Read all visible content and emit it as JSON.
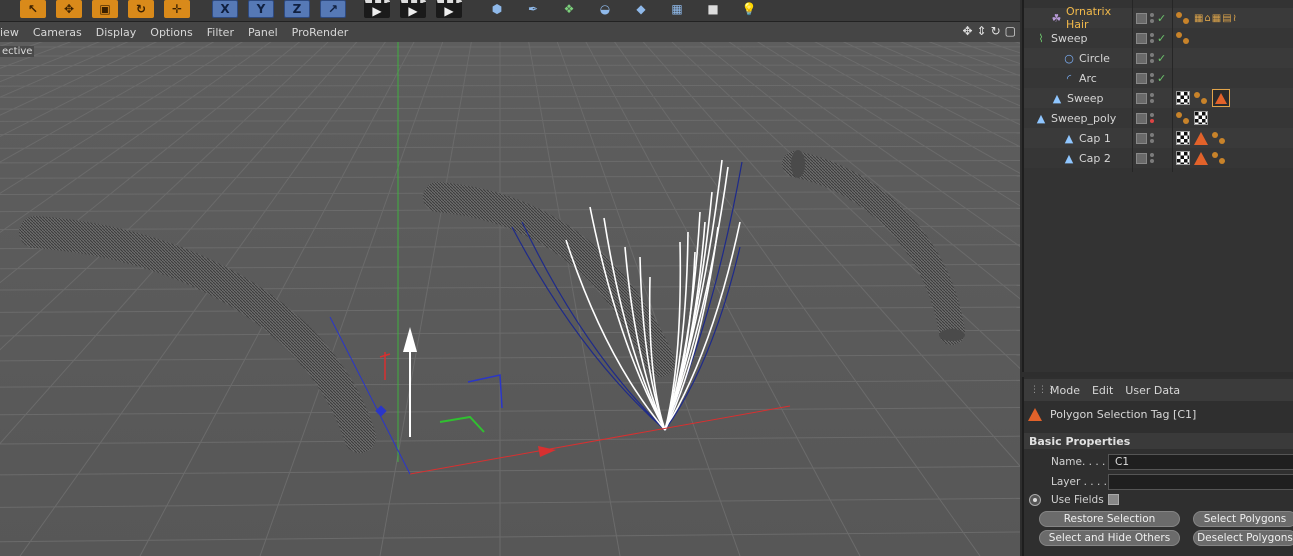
{
  "toolbar": {
    "icons": [
      "undo-arrow-icon",
      "move-icon",
      "scale-icon",
      "rotate-icon",
      "move-all-icon",
      "x-axis-icon",
      "y-axis-icon",
      "z-axis-icon",
      "coordinate-system-icon",
      "render-view-icon",
      "render-picture-viewer-icon",
      "render-settings-icon",
      "cube-icon",
      "spline-pen-icon",
      "generator-icon",
      "deformer-icon",
      "scene-icon",
      "floor-icon",
      "camera-icon",
      "light-icon"
    ],
    "x_label": "X",
    "y_label": "Y",
    "z_label": "Z"
  },
  "viewport": {
    "menu": [
      "iew",
      "Cameras",
      "Display",
      "Options",
      "Filter",
      "Panel",
      "ProRender"
    ],
    "label": "ective",
    "nav_icons": [
      "pan-icon",
      "dolly-icon",
      "rotate-view-icon",
      "maximize-icon"
    ]
  },
  "object_manager": {
    "rows": [
      {
        "name": "Ornatrix Hair",
        "icon": "hair-icon",
        "highlight": true,
        "check": true,
        "tags": [
          "dots",
          "hair-tags"
        ]
      },
      {
        "name": "Sweep",
        "icon": "sweep-icon",
        "check": true,
        "tags": [
          "dots"
        ]
      },
      {
        "name": "Circle",
        "icon": "circle-spline-icon",
        "check": true,
        "tags": []
      },
      {
        "name": "Arc",
        "icon": "arc-spline-icon",
        "check": true,
        "tags": []
      },
      {
        "name": "Sweep",
        "icon": "polygon-object-icon",
        "check": false,
        "tags": [
          "checker",
          "dots",
          "triangle-selected"
        ]
      },
      {
        "name": "Sweep_poly",
        "icon": "polygon-object-icon",
        "check": false,
        "red_dot": true,
        "tags": [
          "dots",
          "checker"
        ]
      },
      {
        "name": "Cap 1",
        "icon": "polygon-object-icon",
        "check": false,
        "tags": [
          "checker",
          "triangle",
          "dots"
        ]
      },
      {
        "name": "Cap 2",
        "icon": "polygon-object-icon",
        "check": false,
        "tags": [
          "checker",
          "triangle",
          "dots"
        ]
      }
    ]
  },
  "attribute_manager": {
    "menu": [
      "Mode",
      "Edit",
      "User Data"
    ],
    "title": "Polygon Selection Tag [C1]",
    "section": "Basic Properties",
    "name_label": "Name. . . .",
    "name_value": "C1",
    "layer_label": "Layer . . . .",
    "layer_value": "",
    "use_fields_label": "Use Fields",
    "buttons": {
      "restore": "Restore Selection",
      "select_polygons": "Select Polygons",
      "select_hide_others": "Select and Hide Others",
      "deselect_polygons": "Deselect Polygons"
    }
  },
  "colors": {
    "accent_orange": "#e2622a",
    "hair_name": "#f0b84a",
    "check_green": "#6cc36c",
    "axis_x": "#e02020",
    "axis_y": "#20a020",
    "axis_z": "#2030c0"
  }
}
